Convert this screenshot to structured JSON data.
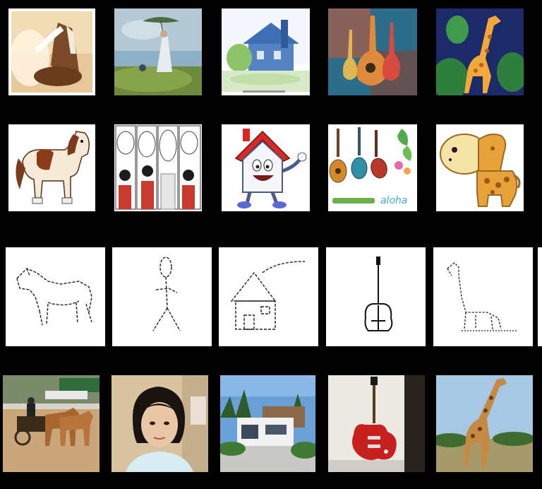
{
  "rows": [
    {
      "style": "painting",
      "items": [
        {
          "subject": "horse"
        },
        {
          "subject": "person"
        },
        {
          "subject": "house"
        },
        {
          "subject": "guitar"
        },
        {
          "subject": "giraffe"
        }
      ]
    },
    {
      "style": "cartoon",
      "items": [
        {
          "subject": "horse"
        },
        {
          "subject": "person"
        },
        {
          "subject": "house"
        },
        {
          "subject": "guitar"
        },
        {
          "subject": "giraffe"
        }
      ]
    },
    {
      "style": "sketch",
      "items": [
        {
          "subject": "horse"
        },
        {
          "subject": "person"
        },
        {
          "subject": "house"
        },
        {
          "subject": "guitar"
        },
        {
          "subject": "giraffe"
        }
      ]
    },
    {
      "style": "photo",
      "items": [
        {
          "subject": "horse"
        },
        {
          "subject": "person"
        },
        {
          "subject": "house"
        },
        {
          "subject": "guitar"
        },
        {
          "subject": "giraffe"
        }
      ]
    }
  ],
  "colors": {
    "background": "#000000",
    "tile_white": "#ffffff",
    "guitar_red": "#c8201e",
    "giraffe_orange": "#e8a23a"
  }
}
